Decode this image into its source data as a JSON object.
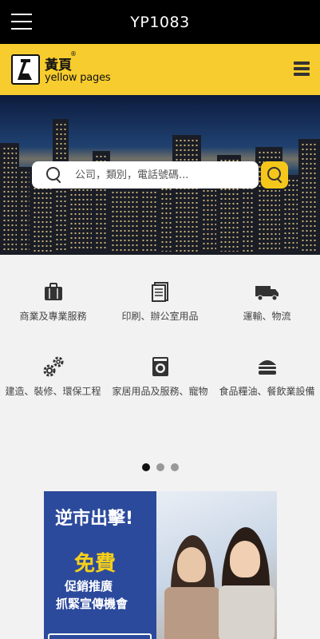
{
  "header": {
    "title": "YP1083"
  },
  "brand": {
    "name_cn": "黃頁",
    "reg_mark": "®",
    "name_en": "yellow pages"
  },
  "search": {
    "placeholder": "公司，類別，電話號碼..."
  },
  "categories": [
    {
      "label": "商業及專業服務",
      "icon": "briefcase-icon"
    },
    {
      "label": "印刷、辦公室用品",
      "icon": "document-icon"
    },
    {
      "label": "運輸、物流",
      "icon": "truck-icon"
    },
    {
      "label": "建造、裝修、環保工程",
      "icon": "gears-icon"
    },
    {
      "label": "家居用品及服務、寵物",
      "icon": "washing-machine-icon"
    },
    {
      "label": "食品糧油、餐飲業設備",
      "icon": "burger-icon"
    }
  ],
  "pager": {
    "count": 3,
    "active": 0
  },
  "ad": {
    "headline": "逆市出擊!",
    "free": "免費",
    "line1": "促銷推廣",
    "line2": "抓緊宣傳機會"
  },
  "colors": {
    "brand_yellow": "#f7cc2e",
    "ad_blue": "#2c4a9c",
    "ad_yellow": "#f7d118"
  }
}
